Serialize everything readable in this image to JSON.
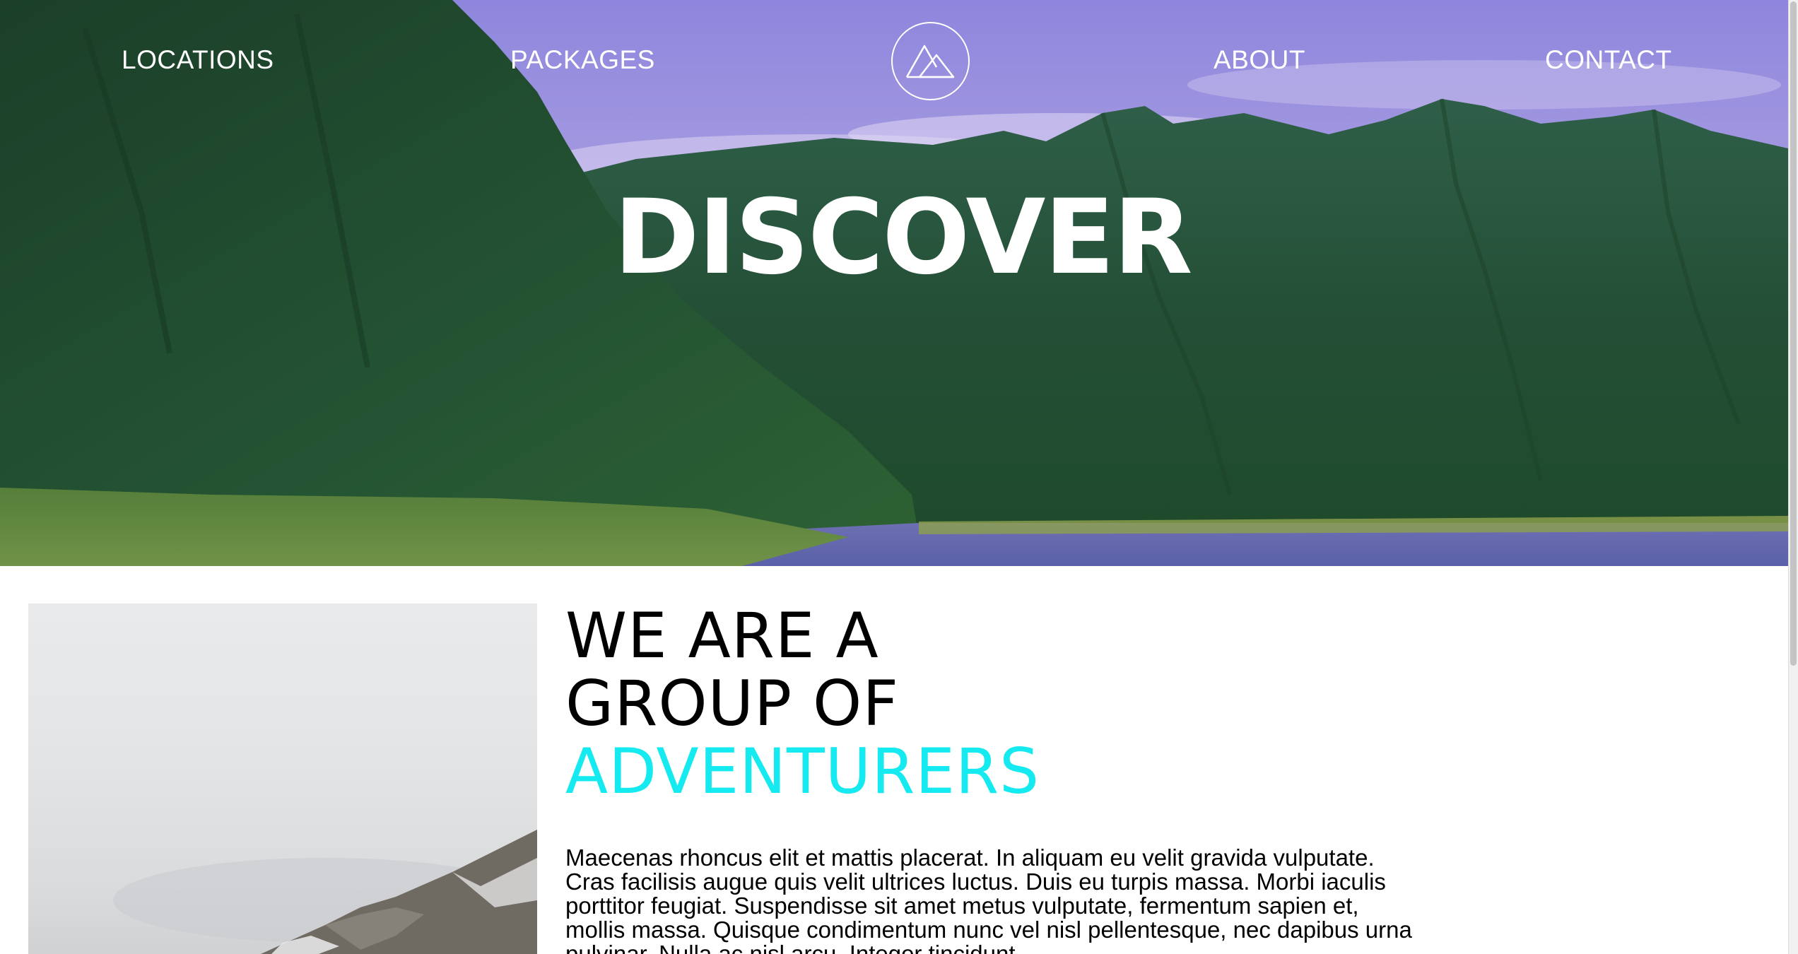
{
  "nav": {
    "locations": "LOCATIONS",
    "packages": "PACKAGES",
    "about": "ABOUT",
    "contact": "CONTACT"
  },
  "hero": {
    "title": "DISCOVER"
  },
  "about": {
    "heading_line1": "WE ARE A",
    "heading_line2": "GROUP OF",
    "heading_line3": "ADVENTURERS",
    "body": "Maecenas rhoncus elit et mattis placerat. In aliquam eu velit gravida vulputate. Cras facilisis augue quis velit ultrices luctus. Duis eu turpis massa. Morbi iaculis porttitor feugiat. Suspendisse sit amet metus vulputate, fermentum sapien et, mollis massa. Quisque condimentum nunc vel nisl pellentesque, nec dapibus urna pulvinar. Nulla ac nisl arcu. Integer tincidunt"
  },
  "colors": {
    "accent": "#14eaf0",
    "text": "#000000",
    "nav_text": "#ffffff"
  }
}
